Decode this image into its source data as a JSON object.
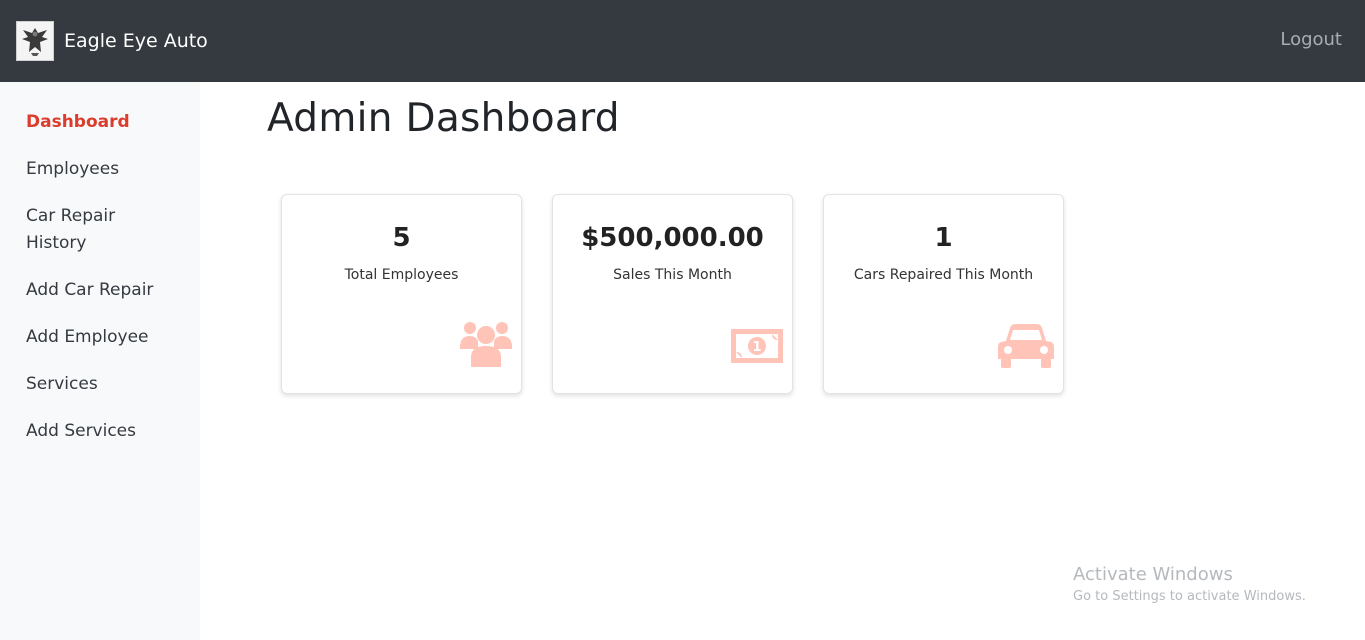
{
  "app": {
    "brand": "Eagle Eye Auto",
    "logout": "Logout"
  },
  "sidebar": {
    "items": [
      {
        "label": "Dashboard",
        "active": true
      },
      {
        "label": "Employees"
      },
      {
        "label": "Car Repair History"
      },
      {
        "label": "Add Car Repair"
      },
      {
        "label": "Add Employee"
      },
      {
        "label": "Services"
      },
      {
        "label": "Add Services"
      }
    ]
  },
  "main": {
    "title": "Admin Dashboard",
    "cards": [
      {
        "value": "5",
        "label": "Total Employees",
        "icon": "users-icon"
      },
      {
        "value": "$500,000.00",
        "label": "Sales This Month",
        "icon": "money-bill-icon"
      },
      {
        "value": "1",
        "label": "Cars Repaired This Month",
        "icon": "car-icon"
      }
    ]
  },
  "watermark": {
    "title": "Activate Windows",
    "subtitle": "Go to Settings to activate Windows."
  },
  "colors": {
    "topbar": "#343a40",
    "sidebar": "#f8f9fa",
    "active": "#dc3c2c",
    "icon": "#ffc3b8"
  }
}
